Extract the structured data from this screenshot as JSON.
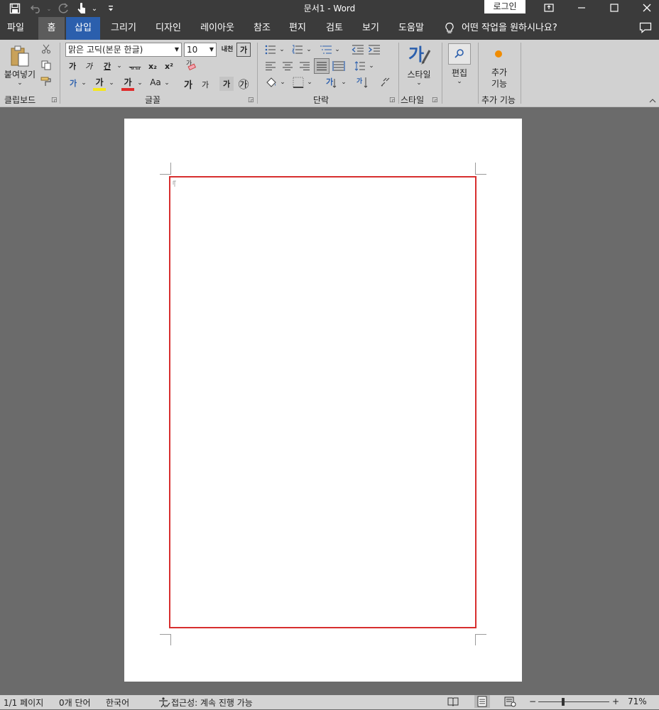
{
  "titlebar": {
    "title": "문서1  -  Word",
    "login_label": "로그인",
    "icons": [
      "save-icon",
      "undo-icon",
      "redo-icon",
      "touch-mode-icon",
      "customize-qat-icon"
    ],
    "window_controls": [
      "ribbon-display-icon",
      "minimize-icon",
      "maximize-icon",
      "close-icon"
    ]
  },
  "menu": {
    "tabs": [
      "파일",
      "홈",
      "삽입",
      "그리기",
      "디자인",
      "레이아웃",
      "참조",
      "편지",
      "검토",
      "보기",
      "도움말"
    ],
    "selected": "홈",
    "highlighted": "삽입",
    "tellme": "어떤 작업을 원하시나요?"
  },
  "ribbon": {
    "clipboard": {
      "paste_label": "붙여넣기",
      "group_label": "클립보드"
    },
    "font": {
      "font_name": "맑은 고딕(본문 한글)",
      "font_size": "10",
      "btn_bold": "가",
      "btn_italic": "가",
      "btn_underline": "간",
      "btn_strike": "ᆪᆸ",
      "btn_sub": "x₂",
      "btn_sup": "x²",
      "btn_texteffect": "가",
      "btn_highlight": "가",
      "btn_fontcolor": "가",
      "btn_case": "Aa",
      "btn_grow": "가",
      "btn_shrink": "가",
      "btn_charshade": "가",
      "btn_enclose": "㉮",
      "btn_phonetic": "내천",
      "btn_border": "가",
      "btn_clear": "가",
      "group_label": "글꼴"
    },
    "paragraph": {
      "group_label": "단락"
    },
    "styles": {
      "styles_label": "스타일",
      "group_label": "스타일"
    },
    "editing": {
      "editing_label": "편집"
    },
    "addins": {
      "addins_label": "추가\n기능",
      "group_label": "추가 기능"
    },
    "colors": {
      "highlight": "#f5e71c",
      "font_color": "#e02a2a",
      "accent": "#2b5fad",
      "addin_dot": "#f08c00"
    }
  },
  "document": {
    "text_box_border_color": "#d72e2e"
  },
  "status": {
    "page": "1/1 페이지",
    "words": "0개 단어",
    "language": "한국어",
    "accessibility": "접근성: 계속 진행 가능",
    "zoom": "71%",
    "zoom_minus": "−",
    "zoom_plus": "+"
  }
}
